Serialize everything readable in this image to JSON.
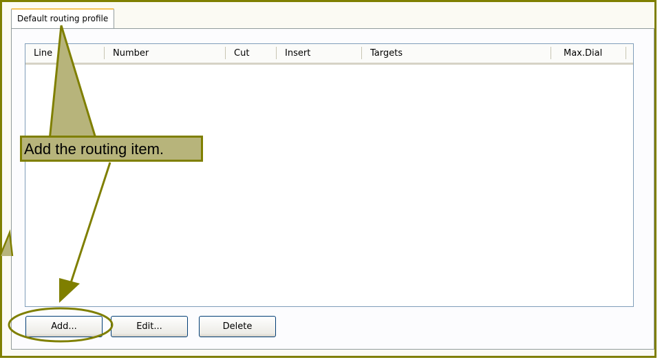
{
  "tab": {
    "label": "Default routing profile"
  },
  "list": {
    "columns": [
      "Line",
      "Number",
      "Cut",
      "Insert",
      "Targets",
      "Max.Dial"
    ],
    "rows": []
  },
  "buttons": {
    "add_label": "Add...",
    "edit_label": "Edit...",
    "delete_label": "Delete"
  },
  "annotation": {
    "callout_text": "Add the routing item.",
    "color": "#7f7f00",
    "fill": "#b7b47b"
  }
}
